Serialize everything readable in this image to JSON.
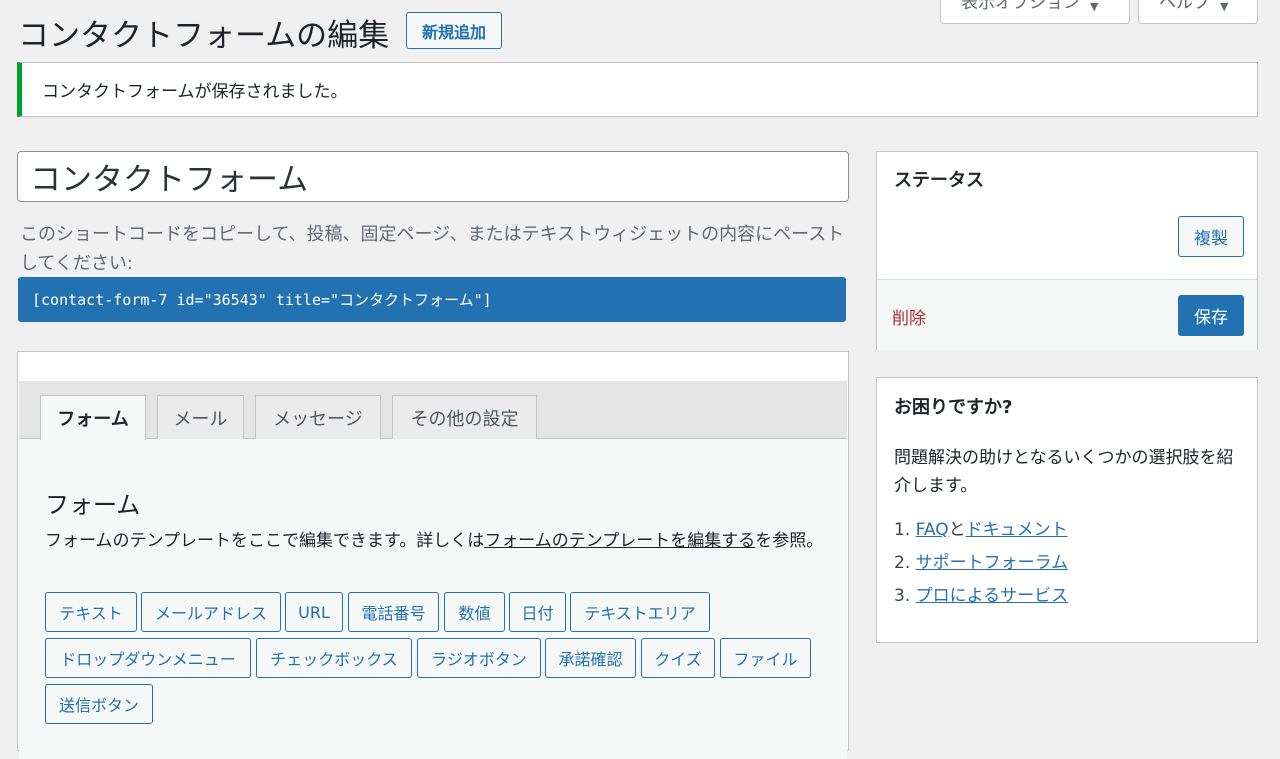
{
  "screen_meta": {
    "options_label": "表示オプション",
    "help_label": "ヘルプ",
    "arrow": "▼"
  },
  "header": {
    "title": "コンタクトフォームの編集",
    "add_new": "新規追加"
  },
  "notice": {
    "text": "コンタクトフォームが保存されました。"
  },
  "form": {
    "title_value": "コンタクトフォーム",
    "shortcode_desc": "このショートコードをコピーして、投稿、固定ページ、またはテキストウィジェットの内容にペーストしてください:",
    "shortcode": "[contact-form-7 id=\"36543\" title=\"コンタクトフォーム\"]"
  },
  "tabs": [
    {
      "label": "フォーム",
      "active": true
    },
    {
      "label": "メール",
      "active": false
    },
    {
      "label": "メッセージ",
      "active": false
    },
    {
      "label": "その他の設定",
      "active": false
    }
  ],
  "panel": {
    "section_title": "フォーム",
    "desc_before": "フォームのテンプレートをここで編集できます。詳しくは",
    "desc_link": "フォームのテンプレートを編集する",
    "desc_after": "を参照。"
  },
  "tag_buttons": [
    "テキスト",
    "メールアドレス",
    "URL",
    "電話番号",
    "数値",
    "日付",
    "テキストエリア",
    "ドロップダウンメニュー",
    "チェックボックス",
    "ラジオボタン",
    "承諾確認",
    "クイズ",
    "ファイル",
    "送信ボタン"
  ],
  "status_box": {
    "title": "ステータス",
    "duplicate": "複製",
    "delete": "削除",
    "save": "保存"
  },
  "help_box": {
    "title": "お困りですか?",
    "desc": "問題解決の助けとなるいくつかの選択肢を紹介します。",
    "items": [
      {
        "num": "1.",
        "link1": "FAQ",
        "mid": "と",
        "link2": "ドキュメント"
      },
      {
        "num": "2.",
        "link1": "サポートフォーラム",
        "mid": "",
        "link2": ""
      },
      {
        "num": "3.",
        "link1": "プロによるサービス",
        "mid": "",
        "link2": ""
      }
    ]
  },
  "colors": {
    "accent": "#2271b1",
    "success": "#00a32a",
    "danger": "#b32d2e",
    "background": "#f0f0f1"
  }
}
